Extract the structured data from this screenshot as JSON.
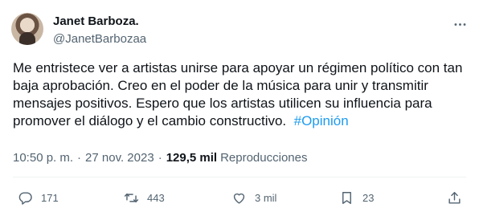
{
  "author": {
    "display_name": "Janet Barboza.",
    "handle": "@JanetBarbozaa"
  },
  "tweet": {
    "text": "Me entristece ver a artistas unirse para apoyar un régimen político con tan baja aprobación. Creo en el poder de la música para unir y transmitir mensajes positivos. Espero que los artistas utilicen su influencia para promover el diálogo y el cambio constructivo.",
    "hashtag": "#Opinión",
    "time": "10:50 p. m.",
    "date": "27 nov. 2023",
    "separator": "·",
    "views_count": "129,5 mil",
    "views_label": "Reproducciones"
  },
  "actions": {
    "replies": "171",
    "retweets": "443",
    "likes": "3 mil",
    "bookmarks": "23"
  },
  "colors": {
    "link": "#1d9bf0",
    "text": "#0f1419",
    "secondary": "#536471"
  }
}
